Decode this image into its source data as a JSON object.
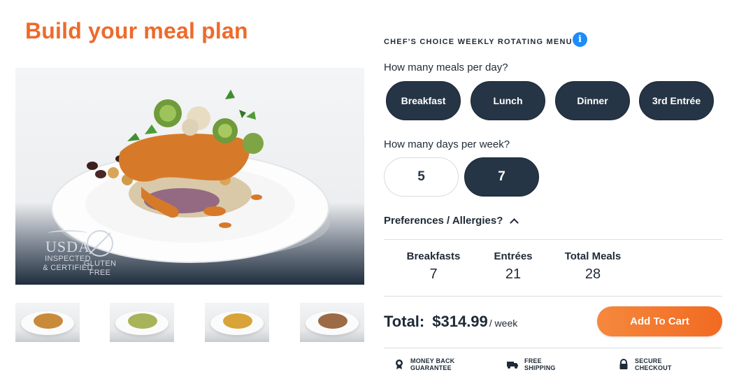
{
  "page": {
    "title": "Build your meal plan"
  },
  "hero": {
    "badges": {
      "usda_mark": "USDA",
      "usda_line1": "INSPECTED",
      "usda_line2": "& CERTIFIED",
      "gf_line1": "GLUTEN",
      "gf_line2": "FREE"
    }
  },
  "thumbnails": [
    {
      "food_color": "#c98a3a"
    },
    {
      "food_color": "#a8b35a"
    },
    {
      "food_color": "#d8a338"
    },
    {
      "food_color": "#9c6a45"
    }
  ],
  "menu": {
    "chef_label": "CHEF'S CHOICE WEEKLY ROTATING MENU",
    "info_icon": "info-icon"
  },
  "meals_per_day": {
    "question": "How many meals per day?",
    "options": [
      "Breakfast",
      "Lunch",
      "Dinner",
      "3rd Entrée"
    ]
  },
  "days_per_week": {
    "question": "How many days per week?",
    "options": [
      "5",
      "7"
    ],
    "selected": "7"
  },
  "preferences": {
    "label": "Preferences / Allergies?"
  },
  "summary": {
    "breakfasts_label": "Breakfasts",
    "breakfasts_value": "7",
    "entrees_label": "Entrées",
    "entrees_value": "21",
    "total_label": "Total Meals",
    "total_value": "28"
  },
  "total": {
    "label": "Total:",
    "price": "$314.99",
    "per": "/ week"
  },
  "cart": {
    "button_label": "Add To Cart"
  },
  "trust": {
    "money_back_1": "MONEY BACK",
    "money_back_2": "GUARANTEE",
    "shipping_1": "FREE",
    "shipping_2": "SHIPPING",
    "secure_1": "SECURE",
    "secure_2": "CHECKOUT"
  },
  "colors": {
    "brand_orange": "#ee6a2b",
    "navy": "#263545",
    "info_blue": "#1d8cf8"
  }
}
